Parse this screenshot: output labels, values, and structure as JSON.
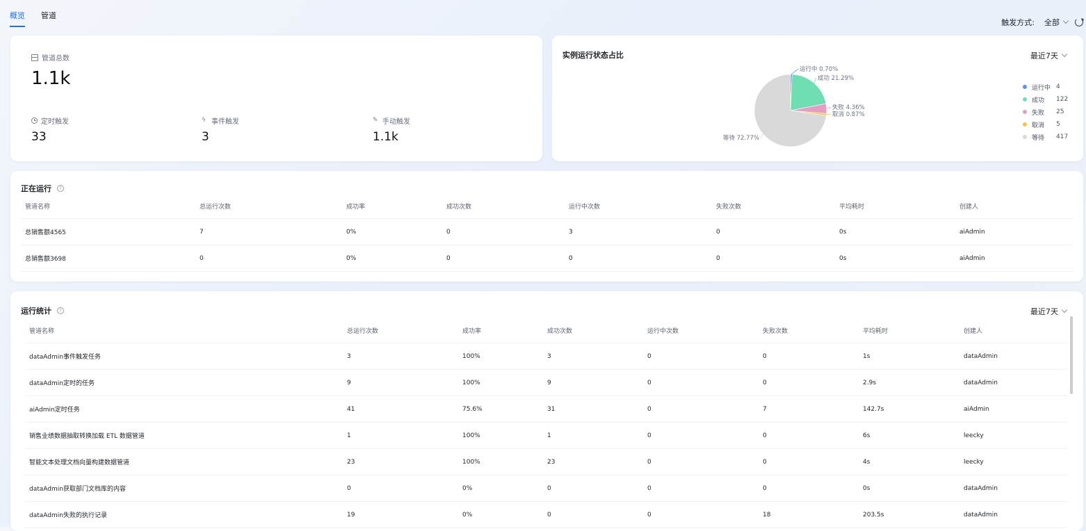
{
  "tabs": [
    {
      "label": "概览",
      "active": true
    },
    {
      "label": "管道",
      "active": false
    }
  ],
  "trigger_filter": {
    "label": "触发方式:",
    "value": "全部"
  },
  "summary": {
    "total_label": "管道总数",
    "total_value": "1.1k",
    "items": [
      {
        "label": "定时触发",
        "value": "33",
        "icon": "clock-icon"
      },
      {
        "label": "事件触发",
        "value": "3",
        "icon": "bolt-icon"
      },
      {
        "label": "手动触发",
        "value": "1.1k",
        "icon": "hand-icon"
      }
    ]
  },
  "status_card": {
    "title": "实例运行状态占比",
    "range": "最近7天",
    "slice_labels": {
      "running": "运行中 0.70%",
      "success": "成功 21.29%",
      "failed": "失败 4.36%",
      "cancel": "取消 0.87%",
      "waiting": "等待 72.77%"
    },
    "legend": [
      {
        "name": "运行中",
        "count": "4",
        "color": "#5b8ff9"
      },
      {
        "name": "成功",
        "count": "122",
        "color": "#6fdfb3"
      },
      {
        "name": "失败",
        "count": "25",
        "color": "#e59ec3"
      },
      {
        "name": "取消",
        "count": "5",
        "color": "#f6c344"
      },
      {
        "name": "等待",
        "count": "417",
        "color": "#d9d9d9"
      }
    ]
  },
  "chart_data": {
    "type": "pie",
    "title": "实例运行状态占比",
    "labels": [
      "运行中",
      "成功",
      "失败",
      "取消",
      "等待"
    ],
    "values": [
      4,
      122,
      25,
      5,
      417
    ],
    "percentages": [
      0.7,
      21.29,
      4.36,
      0.87,
      72.77
    ],
    "colors": [
      "#5b8ff9",
      "#6fdfb3",
      "#e59ec3",
      "#f6c344",
      "#d9d9d9"
    ],
    "legend_position": "right"
  },
  "running": {
    "title": "正在运行",
    "columns": [
      "管道名称",
      "总运行次数",
      "成功率",
      "成功次数",
      "运行中次数",
      "失败次数",
      "平均耗时",
      "创建人"
    ],
    "rows": [
      [
        "总销售额4565",
        "7",
        "0%",
        "0",
        "3",
        "0",
        "0s",
        "aiAdmin"
      ],
      [
        "总销售额3698",
        "0",
        "0%",
        "0",
        "0",
        "0",
        "0s",
        "aiAdmin"
      ]
    ]
  },
  "stats": {
    "title": "运行统计",
    "range": "最近7天",
    "columns": [
      "管道名称",
      "总运行次数",
      "成功率",
      "成功次数",
      "运行中次数",
      "失败次数",
      "平均耗时",
      "创建人"
    ],
    "rows": [
      [
        "dataAdmin事件触发任务",
        "3",
        "100%",
        "3",
        "0",
        "0",
        "1s",
        "dataAdmin"
      ],
      [
        "dataAdmin定时的任务",
        "9",
        "100%",
        "9",
        "0",
        "0",
        "2.9s",
        "dataAdmin"
      ],
      [
        "aiAdmin定时任务",
        "41",
        "75.6%",
        "31",
        "0",
        "7",
        "142.7s",
        "aiAdmin"
      ],
      [
        "销售业绩数据抽取转换加载 ETL 数据管道",
        "1",
        "100%",
        "1",
        "0",
        "0",
        "6s",
        "leecky"
      ],
      [
        "智能文本处理文档向量构建数据管道",
        "23",
        "100%",
        "23",
        "0",
        "0",
        "4s",
        "leecky"
      ],
      [
        "dataAdmin获取部门文档库的内容",
        "0",
        "0%",
        "0",
        "0",
        "0",
        "0s",
        "dataAdmin"
      ],
      [
        "dataAdmin失败的执行记录",
        "19",
        "0%",
        "0",
        "0",
        "18",
        "203.5s",
        "dataAdmin"
      ]
    ]
  }
}
